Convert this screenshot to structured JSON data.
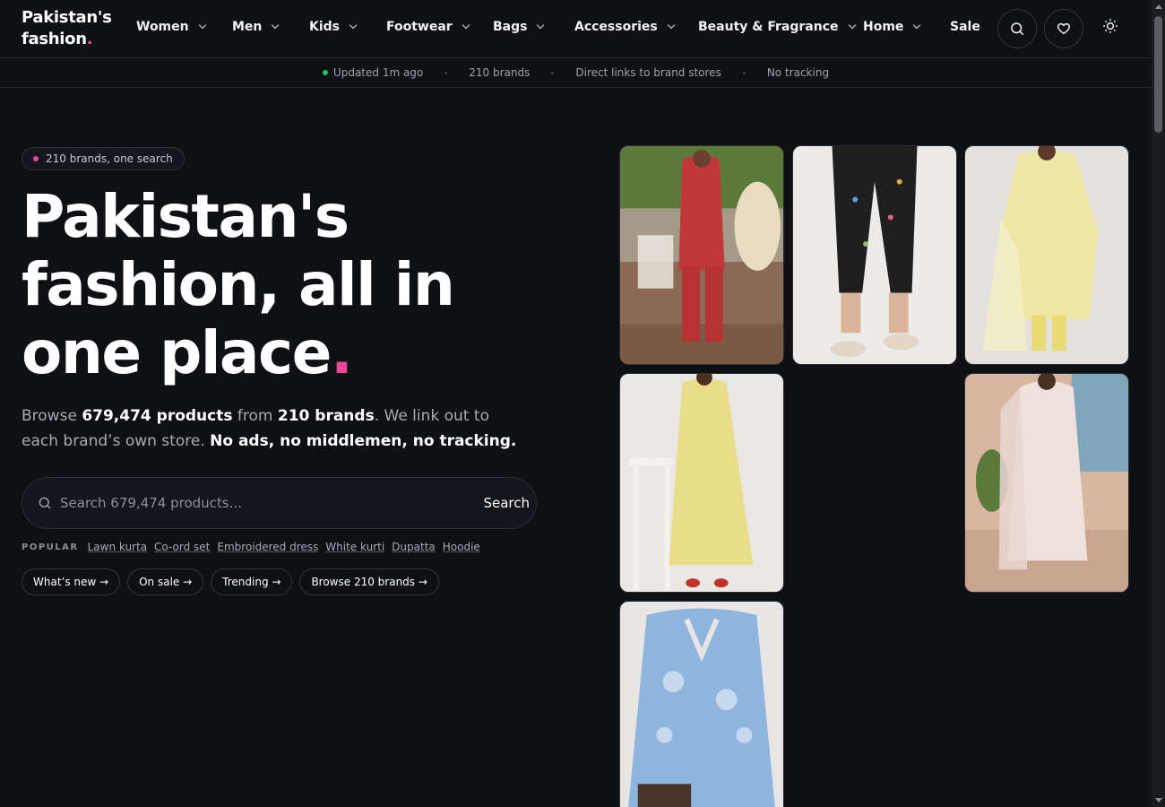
{
  "logo": {
    "line1": "Pakistan's",
    "line2": "fashion",
    "dot": "."
  },
  "nav": {
    "items": [
      {
        "label": "Women",
        "has_menu": true
      },
      {
        "label": "Men",
        "has_menu": true
      },
      {
        "label": "Kids",
        "has_menu": true
      },
      {
        "label": "Footwear",
        "has_menu": true
      },
      {
        "label": "Bags",
        "has_menu": true
      },
      {
        "label": "Accessories",
        "has_menu": true
      },
      {
        "label": "Beauty & Fragrance",
        "has_menu": true
      },
      {
        "label": "Home",
        "has_menu": true
      },
      {
        "label": "Sale",
        "has_menu": false
      }
    ],
    "icons": [
      "search-icon",
      "heart-icon",
      "sun-icon"
    ]
  },
  "subbar": {
    "updated": "Updated 1m ago",
    "brands": "210 brands",
    "links": "Direct links to brand stores",
    "tracking": "No tracking"
  },
  "hero": {
    "pill": "210 brands, one search",
    "headline_line1": "Pakistan's",
    "headline_line2": "fashion, all in",
    "headline_line3": "one place",
    "headline_dot": ".",
    "lede": {
      "p1": "Browse ",
      "products": "679,474 products",
      "p2": " from ",
      "brands": "210 brands",
      "p3": ". We link out to each brand’s own store. ",
      "claim": "No ads, no middlemen, no tracking."
    },
    "search": {
      "placeholder": "Search 679,474 products...",
      "button": "Search"
    },
    "popular_label": "POPULAR",
    "popular": [
      "Lawn kurta",
      "Co-ord set",
      "Embroidered dress",
      "White kurti",
      "Dupatta",
      "Hoodie"
    ],
    "chips": [
      "What’s new →",
      "On sale →",
      "Trending →",
      "Browse 210 brands →"
    ]
  },
  "colors": {
    "accent": "#ec4899",
    "live": "#22c55e",
    "background": "#0f1014"
  }
}
